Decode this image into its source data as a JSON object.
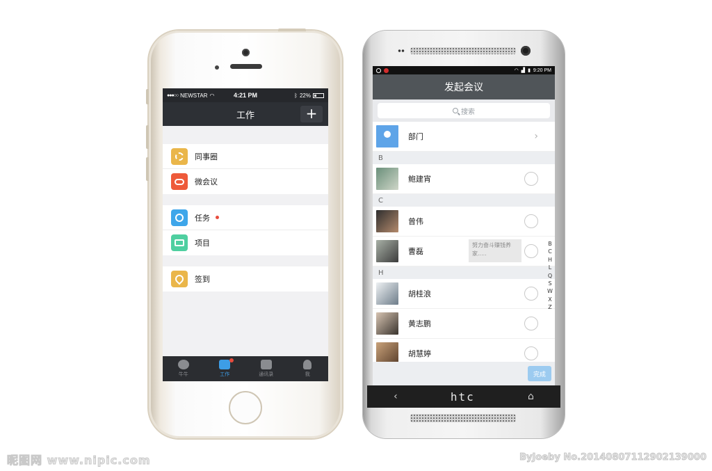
{
  "iphone": {
    "status": {
      "carrier": "NEWSTAR",
      "time": "4:21 PM",
      "battery": "22%"
    },
    "nav": {
      "title": "工作",
      "plus_label": "+"
    },
    "groups": [
      [
        {
          "label": "同事圈",
          "icon": "circle-icon",
          "color": "#eab64a"
        },
        {
          "label": "微会议",
          "icon": "chat-bubble-icon",
          "color": "#ee5a3a"
        }
      ],
      [
        {
          "label": "任务",
          "icon": "check-icon",
          "color": "#3ea6ea"
        },
        {
          "label": "项目",
          "icon": "folder-icon",
          "color": "#4fcfa0"
        }
      ],
      [
        {
          "label": "签到",
          "icon": "location-pin-icon",
          "color": "#eab64a"
        }
      ]
    ],
    "tabs": [
      "牛牛",
      "工作",
      "通讯录",
      "我"
    ]
  },
  "htc": {
    "status": {
      "time": "9:20 PM"
    },
    "nav": {
      "title": "发起会议"
    },
    "search": {
      "placeholder": "搜索"
    },
    "dept": {
      "label": "部门"
    },
    "sections": [
      {
        "letter": "B",
        "contacts": [
          "鲍建宵"
        ]
      },
      {
        "letter": "C",
        "contacts": [
          "曾伟",
          "曹磊"
        ]
      },
      {
        "letter": "H",
        "contacts": [
          "胡桂浪",
          "黄志鹏",
          "胡慧婷"
        ]
      }
    ],
    "tooltip": "努力奋斗赚钱养家.....",
    "index": [
      "B",
      "C",
      "H",
      "L",
      "Q",
      "S",
      "W",
      "X",
      "Z"
    ],
    "done_label": "完成",
    "brand": "htc"
  },
  "watermark": {
    "left": "昵图网 www.nipic.com",
    "right": "ByJoeby No.20140807112902139000"
  }
}
